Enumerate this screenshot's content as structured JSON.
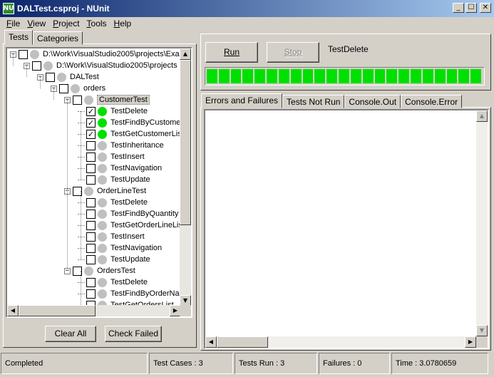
{
  "window": {
    "title": "DALTest.csproj - NUnit",
    "icon_text": "NU",
    "min_glyph": "_",
    "max_glyph": "☐",
    "close_glyph": "✕"
  },
  "menu": [
    {
      "label": "File",
      "accel": "F",
      "rest": "ile"
    },
    {
      "label": "View",
      "accel": "V",
      "rest": "iew"
    },
    {
      "label": "Project",
      "accel": "P",
      "rest": "roject"
    },
    {
      "label": "Tools",
      "accel": "T",
      "rest": "ools"
    },
    {
      "label": "Help",
      "accel": "H",
      "rest": "elp"
    }
  ],
  "left_tabs": [
    "Tests",
    "Categories"
  ],
  "tree": [
    {
      "label": "D:\\Work\\VisualStudio2005\\projects\\Exa",
      "depth": 0,
      "exp": "−",
      "checked": false,
      "dot": "grey"
    },
    {
      "label": "D:\\Work\\VisualStudio2005\\projects",
      "depth": 1,
      "exp": "−",
      "checked": false,
      "dot": "grey"
    },
    {
      "label": "DALTest",
      "depth": 2,
      "exp": "−",
      "checked": false,
      "dot": "grey"
    },
    {
      "label": "orders",
      "depth": 3,
      "exp": "−",
      "checked": false,
      "dot": "grey"
    },
    {
      "label": "CustomerTest",
      "depth": 4,
      "exp": "−",
      "checked": false,
      "dot": "grey",
      "selected": true
    },
    {
      "label": "TestDelete",
      "depth": 5,
      "checked": true,
      "dot": "green"
    },
    {
      "label": "TestFindByCustomer",
      "depth": 5,
      "checked": true,
      "dot": "green"
    },
    {
      "label": "TestGetCustomerLis",
      "depth": 5,
      "checked": true,
      "dot": "green"
    },
    {
      "label": "TestInheritance",
      "depth": 5,
      "checked": false,
      "dot": "grey"
    },
    {
      "label": "TestInsert",
      "depth": 5,
      "checked": false,
      "dot": "grey"
    },
    {
      "label": "TestNavigation",
      "depth": 5,
      "checked": false,
      "dot": "grey"
    },
    {
      "label": "TestUpdate",
      "depth": 5,
      "checked": false,
      "dot": "grey"
    },
    {
      "label": "OrderLineTest",
      "depth": 4,
      "exp": "−",
      "checked": false,
      "dot": "grey"
    },
    {
      "label": "TestDelete",
      "depth": 5,
      "checked": false,
      "dot": "grey"
    },
    {
      "label": "TestFindByQuantity",
      "depth": 5,
      "checked": false,
      "dot": "grey"
    },
    {
      "label": "TestGetOrderLineLis",
      "depth": 5,
      "checked": false,
      "dot": "grey"
    },
    {
      "label": "TestInsert",
      "depth": 5,
      "checked": false,
      "dot": "grey"
    },
    {
      "label": "TestNavigation",
      "depth": 5,
      "checked": false,
      "dot": "grey"
    },
    {
      "label": "TestUpdate",
      "depth": 5,
      "checked": false,
      "dot": "grey"
    },
    {
      "label": "OrdersTest",
      "depth": 4,
      "exp": "−",
      "checked": false,
      "dot": "grey"
    },
    {
      "label": "TestDelete",
      "depth": 5,
      "checked": false,
      "dot": "grey"
    },
    {
      "label": "TestFindByOrderNar",
      "depth": 5,
      "checked": false,
      "dot": "grey"
    },
    {
      "label": "TestGetOrdersList",
      "depth": 5,
      "checked": false,
      "dot": "grey"
    }
  ],
  "buttons": {
    "clear_all": "Clear All",
    "check_failed": "Check Failed",
    "run": "Run",
    "stop": "Stop"
  },
  "current_test": "TestDelete",
  "progress": {
    "segments_filled": 23,
    "segments_total": 23,
    "fraction": 1.0,
    "color": "#00e000"
  },
  "right_tabs": [
    "Errors and Failures",
    "Tests Not Run",
    "Console.Out",
    "Console.Error"
  ],
  "status": {
    "state": "Completed",
    "test_cases": "Test Cases : 3",
    "tests_run": "Tests Run : 3",
    "failures": "Failures : 0",
    "time": "Time : 3.0780659"
  }
}
